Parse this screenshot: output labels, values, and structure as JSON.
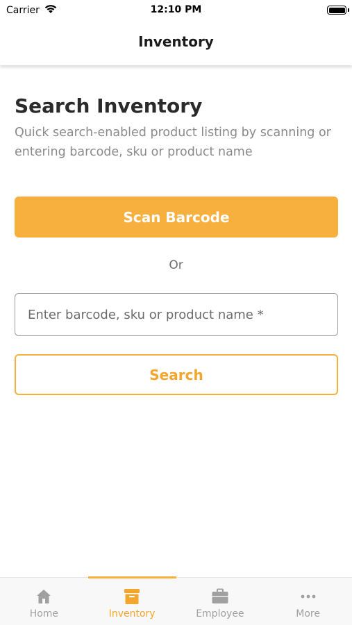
{
  "status_bar": {
    "carrier": "Carrier",
    "time": "12:10 PM"
  },
  "nav": {
    "title": "Inventory"
  },
  "main": {
    "heading": "Search Inventory",
    "subtext": "Quick search-enabled product listing by scanning or entering barcode, sku or product name",
    "scan_label": "Scan Barcode",
    "or_text": "Or",
    "search_placeholder": "Enter barcode, sku or product name *",
    "search_label": "Search"
  },
  "tab_bar": {
    "active": "inventory",
    "tabs": [
      {
        "label": "Home",
        "icon": "home-icon"
      },
      {
        "label": "Inventory",
        "icon": "archive-box-icon"
      },
      {
        "label": "Employee",
        "icon": "briefcase-icon"
      },
      {
        "label": "More",
        "icon": "more-dots-icon"
      }
    ]
  },
  "colors": {
    "accent": "#f7b03e",
    "inactive_tab": "#a0a0a0",
    "text_dark": "#2a2a2a",
    "text_muted": "#8a8a8a"
  }
}
